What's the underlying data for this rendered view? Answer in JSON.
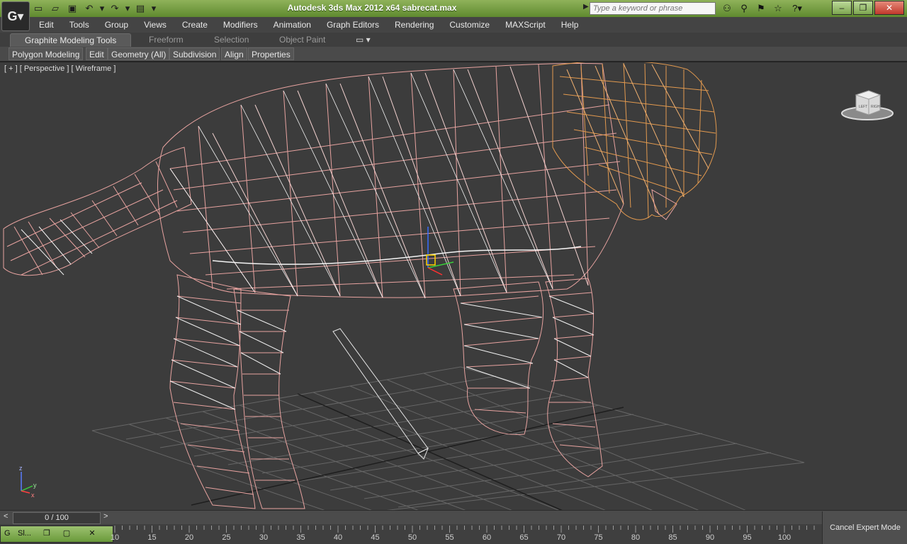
{
  "window": {
    "title": "Autodesk 3ds Max  2012 x64      sabrecat.max",
    "search_placeholder": "Type a keyword or phrase",
    "app_button_icon": "3ds-max-logo-icon"
  },
  "menu": [
    "Edit",
    "Tools",
    "Group",
    "Views",
    "Create",
    "Modifiers",
    "Animation",
    "Graph Editors",
    "Rendering",
    "Customize",
    "MAXScript",
    "Help"
  ],
  "ribbon_tabs": [
    "Graphite Modeling Tools",
    "Freeform",
    "Selection",
    "Object Paint"
  ],
  "ribbon_buttons": [
    "Polygon Modeling",
    "Edit",
    "Geometry (All)",
    "Subdivision",
    "Align",
    "Properties"
  ],
  "viewport": {
    "label": "[ + ] [ Perspective ] [ Wireframe ]",
    "axis_x": "x",
    "axis_y": "y",
    "axis_z": "z",
    "cube_faces": [
      "LEFT",
      "RIGHT"
    ]
  },
  "timeline": {
    "slider_value": "0 / 100",
    "ticks": [
      "10",
      "15",
      "20",
      "25",
      "30",
      "35",
      "40",
      "45",
      "50",
      "55",
      "60",
      "65",
      "70",
      "75",
      "80",
      "85",
      "90",
      "95",
      "100"
    ]
  },
  "taskbar": {
    "label": "Sl..."
  },
  "status": {
    "cancel_expert": "Cancel Expert Mode"
  },
  "colors": {
    "title_green": "#7da650",
    "wire_pink": "#e8a3a0",
    "wire_white": "#f4f4f4",
    "wire_orange": "#e39a4f",
    "grid": "#6a6a6a"
  }
}
